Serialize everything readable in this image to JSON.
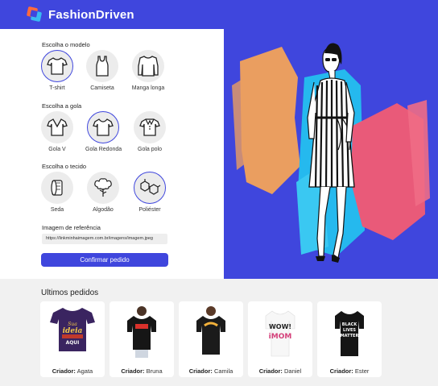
{
  "app": {
    "name": "FashionDriven"
  },
  "colors": {
    "accent": "#3f46dd",
    "panel": "#ffffff",
    "background": "#f1f1f1"
  },
  "model": {
    "title": "Escolha o modelo",
    "options": [
      {
        "label": "T-shirt",
        "icon": "tshirt-icon",
        "selected": true
      },
      {
        "label": "Camiseta",
        "icon": "tanktop-icon",
        "selected": false
      },
      {
        "label": "Manga longa",
        "icon": "longsleeve-icon",
        "selected": false
      }
    ]
  },
  "collar": {
    "title": "Escolha a gola",
    "options": [
      {
        "label": "Gola V",
        "icon": "v-neck-icon",
        "selected": false
      },
      {
        "label": "Gola Redonda",
        "icon": "round-neck-icon",
        "selected": true
      },
      {
        "label": "Gola polo",
        "icon": "polo-collar-icon",
        "selected": false
      }
    ]
  },
  "fabric": {
    "title": "Escolha o tecido",
    "options": [
      {
        "label": "Seda",
        "icon": "silk-roll-icon",
        "selected": false
      },
      {
        "label": "Algodão",
        "icon": "cotton-icon",
        "selected": false
      },
      {
        "label": "Poliéster",
        "icon": "molecule-icon",
        "selected": true
      }
    ]
  },
  "reference": {
    "label": "Imagem de referência",
    "value": "https://linkminhaimagem.com.br/imagens/imagem.jpeg"
  },
  "confirm_label": "Confirmar pedido",
  "orders": {
    "title": "Ultimos pedidos",
    "creator_prefix": "Criador:",
    "items": [
      {
        "creator": "Agata",
        "shirt_color": "#3a2460",
        "print": "Sua ideia AQUI"
      },
      {
        "creator": "Bruna",
        "shirt_color": "#161616",
        "print": ""
      },
      {
        "creator": "Camila",
        "shirt_color": "#1b1b1b",
        "print": "THRASHER"
      },
      {
        "creator": "Daniel",
        "shirt_color": "#f7f7f7",
        "print": "WOW! iMOM"
      },
      {
        "creator": "Ester",
        "shirt_color": "#151515",
        "print": "BLACK LIVES MATTER"
      }
    ]
  }
}
